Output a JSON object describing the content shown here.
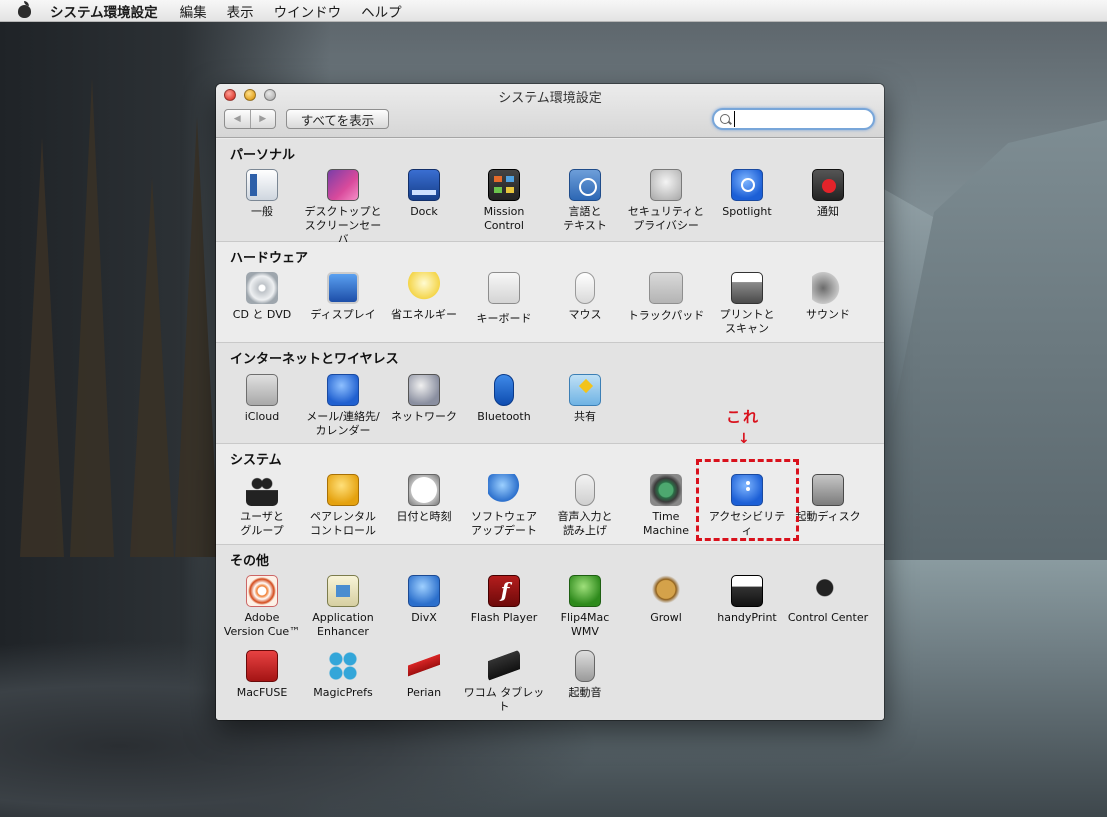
{
  "menubar": {
    "apple": "",
    "app_name": "システム環境設定",
    "items": [
      "編集",
      "表示",
      "ウインドウ",
      "ヘルプ"
    ]
  },
  "window": {
    "title": "システム環境設定",
    "show_all": "すべてを表示",
    "search": {
      "value": "",
      "placeholder": ""
    }
  },
  "sections": [
    {
      "title": "パーソナル",
      "panes": [
        {
          "label": "一般",
          "icon": "general-icon"
        },
        {
          "label": "デスクトップと\nスクリーンセーバ",
          "icon": "desktop-icon"
        },
        {
          "label": "Dock",
          "icon": "dock-icon"
        },
        {
          "label": "Mission\nControl",
          "icon": "mission-control-icon"
        },
        {
          "label": "言語と\nテキスト",
          "icon": "language-icon"
        },
        {
          "label": "セキュリティと\nプライバシー",
          "icon": "security-icon"
        },
        {
          "label": "Spotlight",
          "icon": "spotlight-icon"
        },
        {
          "label": "通知",
          "icon": "notifications-icon"
        }
      ]
    },
    {
      "title": "ハードウェア",
      "panes": [
        {
          "label": "CD と DVD",
          "icon": "cd-dvd-icon"
        },
        {
          "label": "ディスプレイ",
          "icon": "display-icon"
        },
        {
          "label": "省エネルギー",
          "icon": "energy-saver-icon"
        },
        {
          "label": "キーボード",
          "icon": "keyboard-icon"
        },
        {
          "label": "マウス",
          "icon": "mouse-icon"
        },
        {
          "label": "トラックパッド",
          "icon": "trackpad-icon"
        },
        {
          "label": "プリントと\nスキャン",
          "icon": "printer-icon"
        },
        {
          "label": "サウンド",
          "icon": "sound-icon"
        }
      ]
    },
    {
      "title": "インターネットとワイヤレス",
      "panes": [
        {
          "label": "iCloud",
          "icon": "icloud-icon"
        },
        {
          "label": "メール/連絡先/\nカレンダー",
          "icon": "mail-icon"
        },
        {
          "label": "ネットワーク",
          "icon": "network-icon"
        },
        {
          "label": "Bluetooth",
          "icon": "bluetooth-icon"
        },
        {
          "label": "共有",
          "icon": "sharing-icon"
        }
      ]
    },
    {
      "title": "システム",
      "panes": [
        {
          "label": "ユーザと\nグループ",
          "icon": "users-icon"
        },
        {
          "label": "ペアレンタル\nコントロール",
          "icon": "parental-icon"
        },
        {
          "label": "日付と時刻",
          "icon": "clock-icon"
        },
        {
          "label": "ソフトウェア\nアップデート",
          "icon": "update-icon"
        },
        {
          "label": "音声入力と\n読み上げ",
          "icon": "microphone-icon"
        },
        {
          "label": "Time\nMachine",
          "icon": "time-machine-icon"
        },
        {
          "label": "アクセシビリティ",
          "icon": "accessibility-icon"
        },
        {
          "label": "起動ディスク",
          "icon": "startup-disk-icon"
        }
      ]
    },
    {
      "title": "その他",
      "panes": [
        {
          "label": "Adobe\nVersion Cue™",
          "icon": "adobe-icon"
        },
        {
          "label": "Application\nEnhancer",
          "icon": "app-enhancer-icon"
        },
        {
          "label": "DivX",
          "icon": "divx-icon"
        },
        {
          "label": "Flash Player",
          "icon": "flash-icon"
        },
        {
          "label": "Flip4Mac\nWMV",
          "icon": "flip4mac-icon"
        },
        {
          "label": "Growl",
          "icon": "growl-icon"
        },
        {
          "label": "handyPrint",
          "icon": "handyprint-icon"
        },
        {
          "label": "Control Center",
          "icon": "logicool-icon"
        },
        {
          "label": "MacFUSE",
          "icon": "macfuse-icon"
        },
        {
          "label": "MagicPrefs",
          "icon": "magicprefs-icon"
        },
        {
          "label": "Perian",
          "icon": "perian-icon"
        },
        {
          "label": "ワコム タブレット",
          "icon": "wacom-icon"
        },
        {
          "label": "起動音",
          "icon": "startup-sound-icon"
        }
      ]
    }
  ],
  "annotation": {
    "text": "これ",
    "arrow": "↓",
    "color": "#d9111c"
  }
}
